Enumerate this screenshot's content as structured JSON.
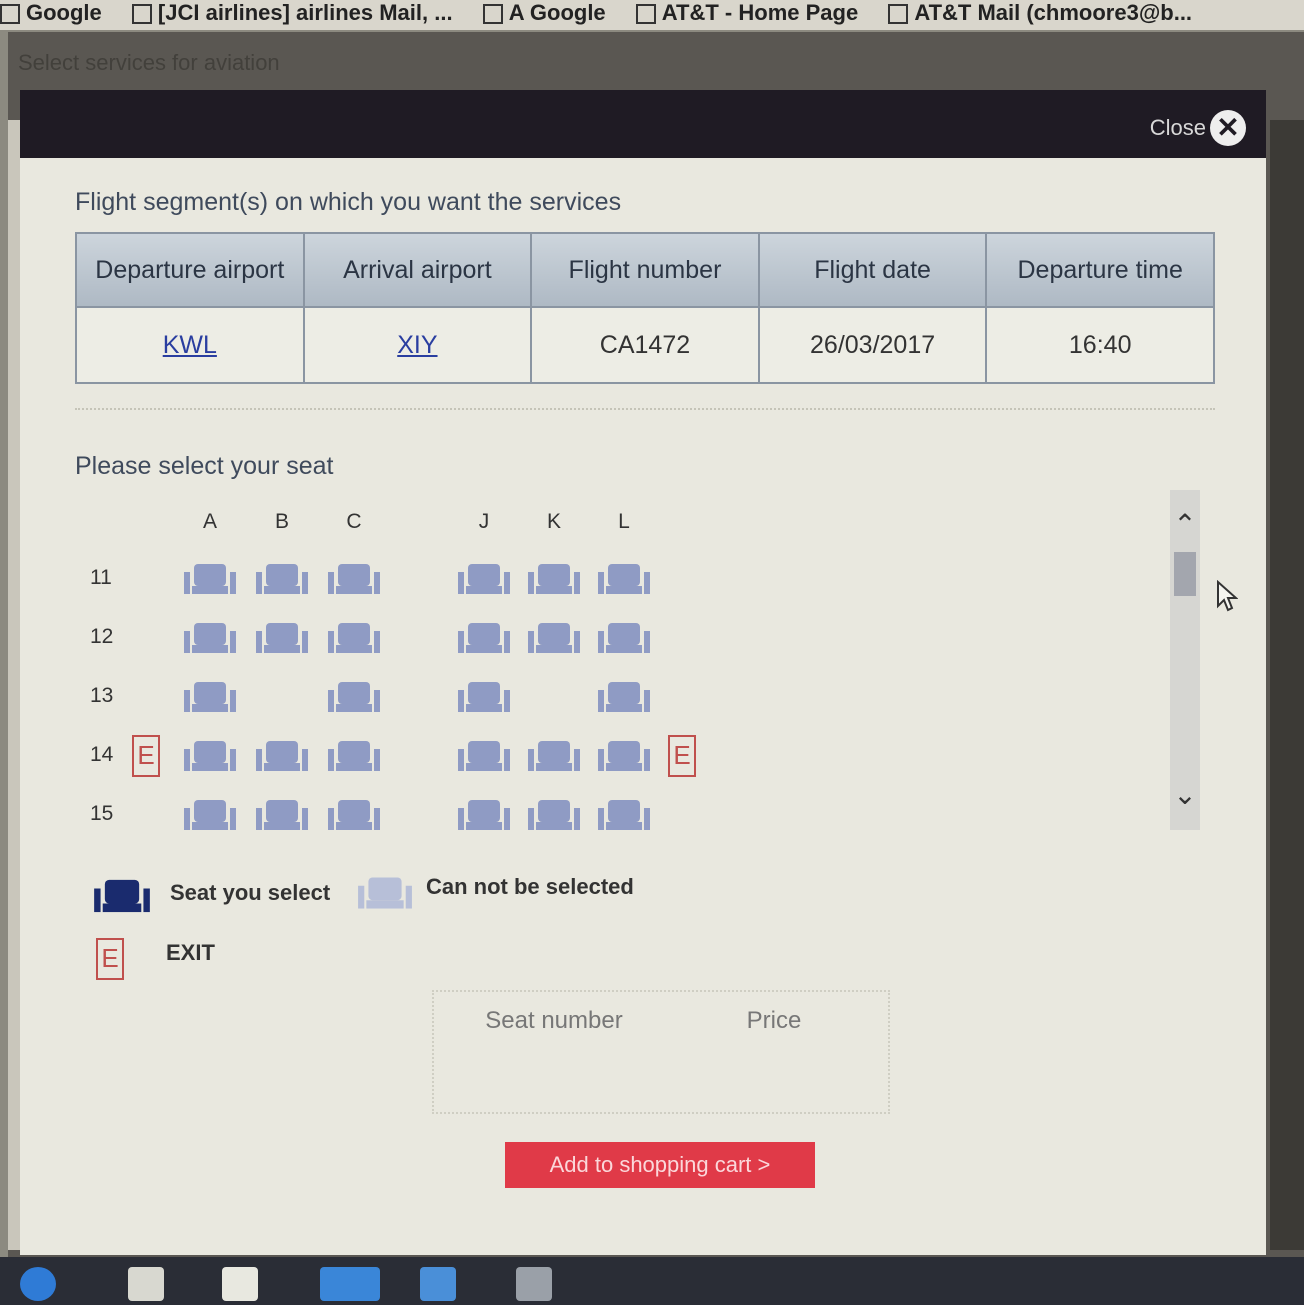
{
  "browser": {
    "bookmarks": [
      "Google",
      "[JCI airlines] airlines Mail, ...",
      "A Google",
      "AT&T - Home Page",
      "AT&T Mail (chmoore3@b..."
    ]
  },
  "page": {
    "heading": "Select services for aviation"
  },
  "modal": {
    "close_label": "Close",
    "segments_title": "Flight segment(s) on which you want the services",
    "table": {
      "headers": [
        "Departure airport",
        "Arrival airport",
        "Flight number",
        "Flight date",
        "Departure time"
      ],
      "row": [
        "KWL",
        "XIY",
        "CA1472",
        "26/03/2017",
        "16:40"
      ]
    },
    "seat_title": "Please select your seat",
    "columns": [
      "A",
      "B",
      "C",
      "J",
      "K",
      "L"
    ],
    "rows": [
      {
        "number": "11",
        "seats": [
          "A",
          "B",
          "C",
          "J",
          "K",
          "L"
        ],
        "exit": false
      },
      {
        "number": "12",
        "seats": [
          "A",
          "B",
          "C",
          "J",
          "K",
          "L"
        ],
        "exit": false
      },
      {
        "number": "13",
        "seats": [
          "A",
          "C",
          "J",
          "L"
        ],
        "exit": false
      },
      {
        "number": "14",
        "seats": [
          "A",
          "B",
          "C",
          "J",
          "K",
          "L"
        ],
        "exit": true
      },
      {
        "number": "15",
        "seats": [
          "A",
          "B",
          "C",
          "J",
          "K",
          "L"
        ],
        "exit": false
      }
    ],
    "exit_marker": "E",
    "legend": {
      "selected": "Seat you select",
      "unavailable": "Can not be selected",
      "exit": "EXIT"
    },
    "summary": {
      "seat_number": "Seat number",
      "price": "Price"
    },
    "add_to_cart": "Add to shopping cart >",
    "colors": {
      "seat_selected": "#1a2b6e",
      "seat_unavailable": "#8f9bc4",
      "exit": "#c0504d",
      "cart_button": "#e03a48"
    }
  }
}
